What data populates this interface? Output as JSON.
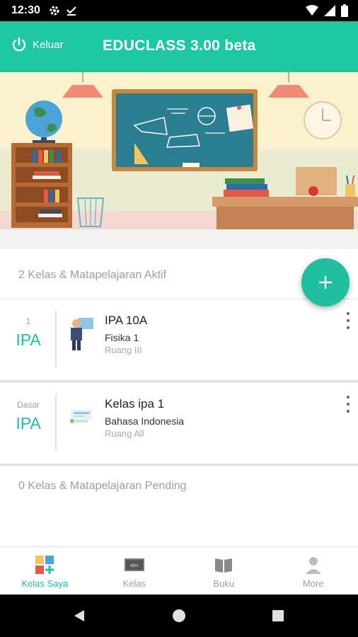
{
  "status_bar": {
    "time": "12:30",
    "icons": [
      "settings-gear-icon",
      "download-done-icon",
      "wifi-icon",
      "signal-icon",
      "battery-icon"
    ]
  },
  "header": {
    "logout_label": "Keluar",
    "title": "EDUCLASS 3.00 beta",
    "accent_color": "#1fc7a0"
  },
  "sections": {
    "active_label": "2 Kelas & Matapelajaran Aktif",
    "pending_label": "0 Kelas & Matapelajaran Pending"
  },
  "classes": [
    {
      "level": "1",
      "abbr": "IPA",
      "name": "IPA 10A",
      "subject": "Fisika 1",
      "room": "Ruang III",
      "thumbnail": "teacher-icon"
    },
    {
      "level": "Dasar",
      "abbr": "IPA",
      "name": "Kelas ipa 1",
      "subject": "Bahasa Indonesia",
      "room": "Ruang All",
      "thumbnail": "classroom-icon"
    }
  ],
  "fab_icon": "plus-icon",
  "bottom_nav": [
    {
      "label": "Kelas Saya",
      "icon": "kelas-saya-icon",
      "active": true
    },
    {
      "label": "Kelas",
      "icon": "chalkboard-icon",
      "active": false
    },
    {
      "label": "Buku",
      "icon": "book-icon",
      "active": false
    },
    {
      "label": "More",
      "icon": "person-icon",
      "active": false
    }
  ],
  "system_nav": [
    "back-icon",
    "home-icon",
    "recents-icon"
  ]
}
